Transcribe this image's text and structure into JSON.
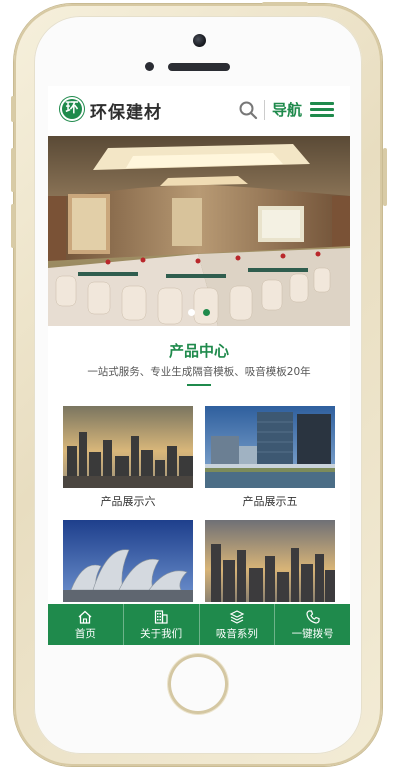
{
  "header": {
    "logo_mark": "环",
    "logo_text": "环保建材",
    "nav_label": "导航",
    "search_icon": "search-icon",
    "menu_icon": "hamburger-menu-icon"
  },
  "banner": {
    "image": "conference-hall-photo",
    "slides": 2,
    "active_slide": 2
  },
  "section": {
    "title": "产品中心",
    "subtitle": "一站式服务、专业生成隔音模板、吸音模板20年"
  },
  "products": [
    {
      "label": "产品展示六",
      "image": "city-skyline-sunset-photo"
    },
    {
      "label": "产品展示五",
      "image": "glass-towers-waterfront-photo"
    },
    {
      "label": "",
      "image": "modern-metal-building-photo"
    },
    {
      "label": "",
      "image": "city-skyline-dusk-photo"
    }
  ],
  "tabbar": {
    "items": [
      {
        "label": "首页",
        "icon": "home-icon"
      },
      {
        "label": "关于我们",
        "icon": "building-icon"
      },
      {
        "label": "吸音系列",
        "icon": "layers-icon"
      },
      {
        "label": "一键拨号",
        "icon": "phone-icon"
      }
    ]
  },
  "colors": {
    "accent": "#1f8a4c",
    "text": "#333333",
    "phone_frame": "#e8ddc0"
  }
}
